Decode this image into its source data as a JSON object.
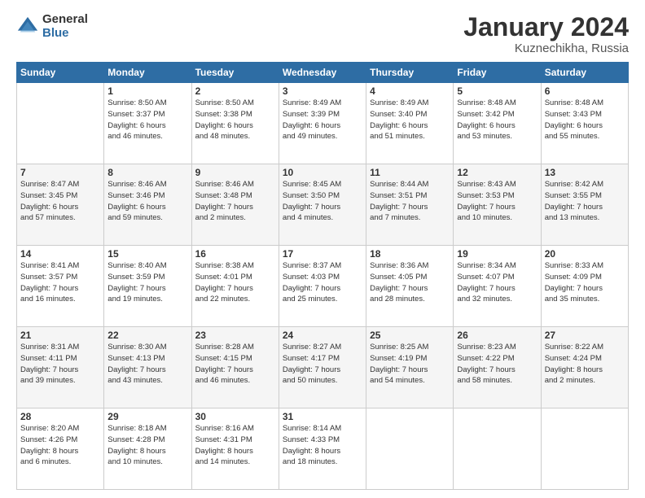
{
  "logo": {
    "general": "General",
    "blue": "Blue"
  },
  "header": {
    "month": "January 2024",
    "location": "Kuznechikha, Russia"
  },
  "weekdays": [
    "Sunday",
    "Monday",
    "Tuesday",
    "Wednesday",
    "Thursday",
    "Friday",
    "Saturday"
  ],
  "weeks": [
    [
      {
        "day": "",
        "sunrise": "",
        "sunset": "",
        "daylight": ""
      },
      {
        "day": "1",
        "sunrise": "Sunrise: 8:50 AM",
        "sunset": "Sunset: 3:37 PM",
        "daylight": "Daylight: 6 hours and 46 minutes."
      },
      {
        "day": "2",
        "sunrise": "Sunrise: 8:50 AM",
        "sunset": "Sunset: 3:38 PM",
        "daylight": "Daylight: 6 hours and 48 minutes."
      },
      {
        "day": "3",
        "sunrise": "Sunrise: 8:49 AM",
        "sunset": "Sunset: 3:39 PM",
        "daylight": "Daylight: 6 hours and 49 minutes."
      },
      {
        "day": "4",
        "sunrise": "Sunrise: 8:49 AM",
        "sunset": "Sunset: 3:40 PM",
        "daylight": "Daylight: 6 hours and 51 minutes."
      },
      {
        "day": "5",
        "sunrise": "Sunrise: 8:48 AM",
        "sunset": "Sunset: 3:42 PM",
        "daylight": "Daylight: 6 hours and 53 minutes."
      },
      {
        "day": "6",
        "sunrise": "Sunrise: 8:48 AM",
        "sunset": "Sunset: 3:43 PM",
        "daylight": "Daylight: 6 hours and 55 minutes."
      }
    ],
    [
      {
        "day": "7",
        "sunrise": "Sunrise: 8:47 AM",
        "sunset": "Sunset: 3:45 PM",
        "daylight": "Daylight: 6 hours and 57 minutes."
      },
      {
        "day": "8",
        "sunrise": "Sunrise: 8:46 AM",
        "sunset": "Sunset: 3:46 PM",
        "daylight": "Daylight: 6 hours and 59 minutes."
      },
      {
        "day": "9",
        "sunrise": "Sunrise: 8:46 AM",
        "sunset": "Sunset: 3:48 PM",
        "daylight": "Daylight: 7 hours and 2 minutes."
      },
      {
        "day": "10",
        "sunrise": "Sunrise: 8:45 AM",
        "sunset": "Sunset: 3:50 PM",
        "daylight": "Daylight: 7 hours and 4 minutes."
      },
      {
        "day": "11",
        "sunrise": "Sunrise: 8:44 AM",
        "sunset": "Sunset: 3:51 PM",
        "daylight": "Daylight: 7 hours and 7 minutes."
      },
      {
        "day": "12",
        "sunrise": "Sunrise: 8:43 AM",
        "sunset": "Sunset: 3:53 PM",
        "daylight": "Daylight: 7 hours and 10 minutes."
      },
      {
        "day": "13",
        "sunrise": "Sunrise: 8:42 AM",
        "sunset": "Sunset: 3:55 PM",
        "daylight": "Daylight: 7 hours and 13 minutes."
      }
    ],
    [
      {
        "day": "14",
        "sunrise": "Sunrise: 8:41 AM",
        "sunset": "Sunset: 3:57 PM",
        "daylight": "Daylight: 7 hours and 16 minutes."
      },
      {
        "day": "15",
        "sunrise": "Sunrise: 8:40 AM",
        "sunset": "Sunset: 3:59 PM",
        "daylight": "Daylight: 7 hours and 19 minutes."
      },
      {
        "day": "16",
        "sunrise": "Sunrise: 8:38 AM",
        "sunset": "Sunset: 4:01 PM",
        "daylight": "Daylight: 7 hours and 22 minutes."
      },
      {
        "day": "17",
        "sunrise": "Sunrise: 8:37 AM",
        "sunset": "Sunset: 4:03 PM",
        "daylight": "Daylight: 7 hours and 25 minutes."
      },
      {
        "day": "18",
        "sunrise": "Sunrise: 8:36 AM",
        "sunset": "Sunset: 4:05 PM",
        "daylight": "Daylight: 7 hours and 28 minutes."
      },
      {
        "day": "19",
        "sunrise": "Sunrise: 8:34 AM",
        "sunset": "Sunset: 4:07 PM",
        "daylight": "Daylight: 7 hours and 32 minutes."
      },
      {
        "day": "20",
        "sunrise": "Sunrise: 8:33 AM",
        "sunset": "Sunset: 4:09 PM",
        "daylight": "Daylight: 7 hours and 35 minutes."
      }
    ],
    [
      {
        "day": "21",
        "sunrise": "Sunrise: 8:31 AM",
        "sunset": "Sunset: 4:11 PM",
        "daylight": "Daylight: 7 hours and 39 minutes."
      },
      {
        "day": "22",
        "sunrise": "Sunrise: 8:30 AM",
        "sunset": "Sunset: 4:13 PM",
        "daylight": "Daylight: 7 hours and 43 minutes."
      },
      {
        "day": "23",
        "sunrise": "Sunrise: 8:28 AM",
        "sunset": "Sunset: 4:15 PM",
        "daylight": "Daylight: 7 hours and 46 minutes."
      },
      {
        "day": "24",
        "sunrise": "Sunrise: 8:27 AM",
        "sunset": "Sunset: 4:17 PM",
        "daylight": "Daylight: 7 hours and 50 minutes."
      },
      {
        "day": "25",
        "sunrise": "Sunrise: 8:25 AM",
        "sunset": "Sunset: 4:19 PM",
        "daylight": "Daylight: 7 hours and 54 minutes."
      },
      {
        "day": "26",
        "sunrise": "Sunrise: 8:23 AM",
        "sunset": "Sunset: 4:22 PM",
        "daylight": "Daylight: 7 hours and 58 minutes."
      },
      {
        "day": "27",
        "sunrise": "Sunrise: 8:22 AM",
        "sunset": "Sunset: 4:24 PM",
        "daylight": "Daylight: 8 hours and 2 minutes."
      }
    ],
    [
      {
        "day": "28",
        "sunrise": "Sunrise: 8:20 AM",
        "sunset": "Sunset: 4:26 PM",
        "daylight": "Daylight: 8 hours and 6 minutes."
      },
      {
        "day": "29",
        "sunrise": "Sunrise: 8:18 AM",
        "sunset": "Sunset: 4:28 PM",
        "daylight": "Daylight: 8 hours and 10 minutes."
      },
      {
        "day": "30",
        "sunrise": "Sunrise: 8:16 AM",
        "sunset": "Sunset: 4:31 PM",
        "daylight": "Daylight: 8 hours and 14 minutes."
      },
      {
        "day": "31",
        "sunrise": "Sunrise: 8:14 AM",
        "sunset": "Sunset: 4:33 PM",
        "daylight": "Daylight: 8 hours and 18 minutes."
      },
      {
        "day": "",
        "sunrise": "",
        "sunset": "",
        "daylight": ""
      },
      {
        "day": "",
        "sunrise": "",
        "sunset": "",
        "daylight": ""
      },
      {
        "day": "",
        "sunrise": "",
        "sunset": "",
        "daylight": ""
      }
    ]
  ]
}
